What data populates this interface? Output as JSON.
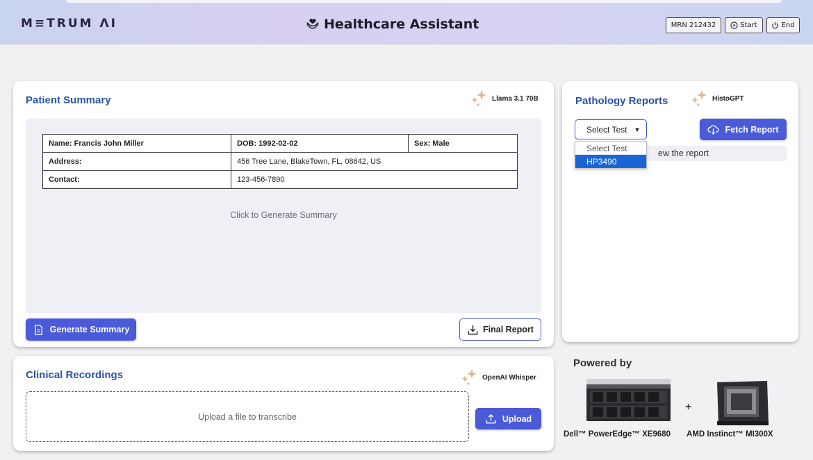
{
  "header": {
    "logo": "M≡TRUM ΛI",
    "title": "Healthcare Assistant",
    "mrn": "MRN 212432",
    "start_label": "Start",
    "end_label": "End"
  },
  "patient_summary": {
    "title": "Patient Summary",
    "model": "Llama 3.1 70B",
    "table": {
      "name": "Name: Francis John Miller",
      "dob": "DOB: 1992-02-02",
      "sex": "Sex: Male",
      "address_label": "Address:",
      "address_value": "456 Tree Lane, BlakeTown, FL, 08642, US",
      "contact_label": "Contact:",
      "contact_value": "123-456-7890"
    },
    "hint": "Click to Generate Summary",
    "generate_button": "Generate Summary",
    "final_report_button": "Final Report"
  },
  "pathology": {
    "title": "Pathology Reports",
    "model": "HistoGPT",
    "select_value": "Select Test",
    "options": [
      "Select Test",
      "HP3490"
    ],
    "selected_option": "HP3490",
    "fetch_button": "Fetch Report",
    "hint_visible": "ew the report"
  },
  "recordings": {
    "title": "Clinical Recordings",
    "model": "OpenAI Whisper",
    "upload_hint": "Upload a file to transcribe",
    "upload_button": "Upload"
  },
  "powered_by": {
    "title": "Powered by",
    "plus": "+",
    "hardware": [
      {
        "label": "Dell™ PowerEdge™ XE9680",
        "icon": "server-image"
      },
      {
        "label": "AMD Instinct™ MI300X",
        "icon": "gpu-chip-image"
      }
    ]
  },
  "colors": {
    "accent": "#4a5ad8",
    "title_blue": "#2a54a6",
    "sparkle": "#e0b890"
  }
}
